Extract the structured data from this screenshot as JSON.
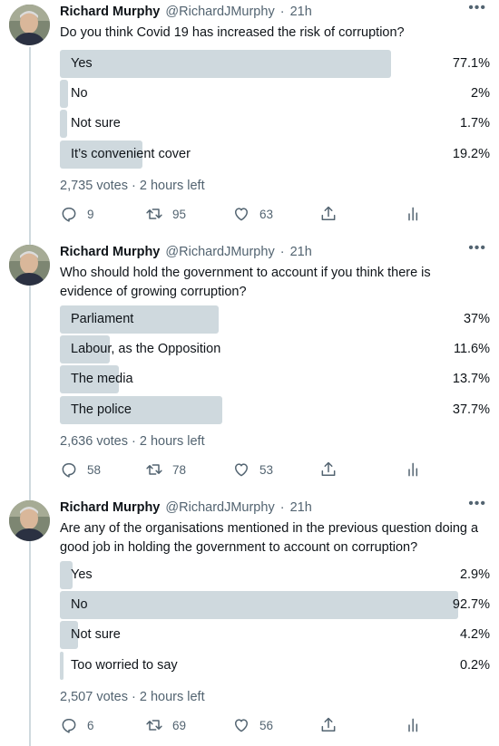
{
  "tweets": [
    {
      "author": {
        "name": "Richard Murphy",
        "handle": "@RichardJMurphy",
        "time": "21h"
      },
      "question": "Do you think Covid 19 has increased the risk of corruption?",
      "options": [
        {
          "label": "Yes",
          "percent": "77.1%",
          "value": 77.1
        },
        {
          "label": "No",
          "percent": "2%",
          "value": 2
        },
        {
          "label": "Not sure",
          "percent": "1.7%",
          "value": 1.7
        },
        {
          "label": "It’s convenient cover",
          "percent": "19.2%",
          "value": 19.2
        }
      ],
      "votes": "2,735 votes · 2 hours left",
      "actions": {
        "replies": "9",
        "retweets": "95",
        "likes": "63"
      }
    },
    {
      "author": {
        "name": "Richard Murphy",
        "handle": "@RichardJMurphy",
        "time": "21h"
      },
      "question": "Who should hold the government to account if you think there is evidence of growing corruption?",
      "options": [
        {
          "label": "Parliament",
          "percent": "37%",
          "value": 37
        },
        {
          "label": "Labour, as the Opposition",
          "percent": "11.6%",
          "value": 11.6
        },
        {
          "label": "The media",
          "percent": "13.7%",
          "value": 13.7
        },
        {
          "label": "The police",
          "percent": "37.7%",
          "value": 37.7
        }
      ],
      "votes": "2,636 votes · 2 hours left",
      "actions": {
        "replies": "58",
        "retweets": "78",
        "likes": "53"
      }
    },
    {
      "author": {
        "name": "Richard Murphy",
        "handle": "@RichardJMurphy",
        "time": "21h"
      },
      "question": "Are any of the organisations mentioned in the previous question doing a good job in holding the government to account on corruption?",
      "options": [
        {
          "label": "Yes",
          "percent": "2.9%",
          "value": 2.9
        },
        {
          "label": "No",
          "percent": "92.7%",
          "value": 92.7
        },
        {
          "label": "Not sure",
          "percent": "4.2%",
          "value": 4.2
        },
        {
          "label": "Too worried to say",
          "percent": "0.2%",
          "value": 0.2
        }
      ],
      "votes": "2,507 votes · 2 hours left",
      "actions": {
        "replies": "6",
        "retweets": "69",
        "likes": "56"
      }
    }
  ],
  "icons": {
    "more": "more-icon",
    "reply": "reply-icon",
    "retweet": "retweet-icon",
    "like": "like-icon",
    "share": "share-icon",
    "analytics": "analytics-icon"
  },
  "colors": {
    "bar": "#cfd9de",
    "text": "#0f1419",
    "muted": "#536471",
    "thread": "#cfd9de"
  }
}
